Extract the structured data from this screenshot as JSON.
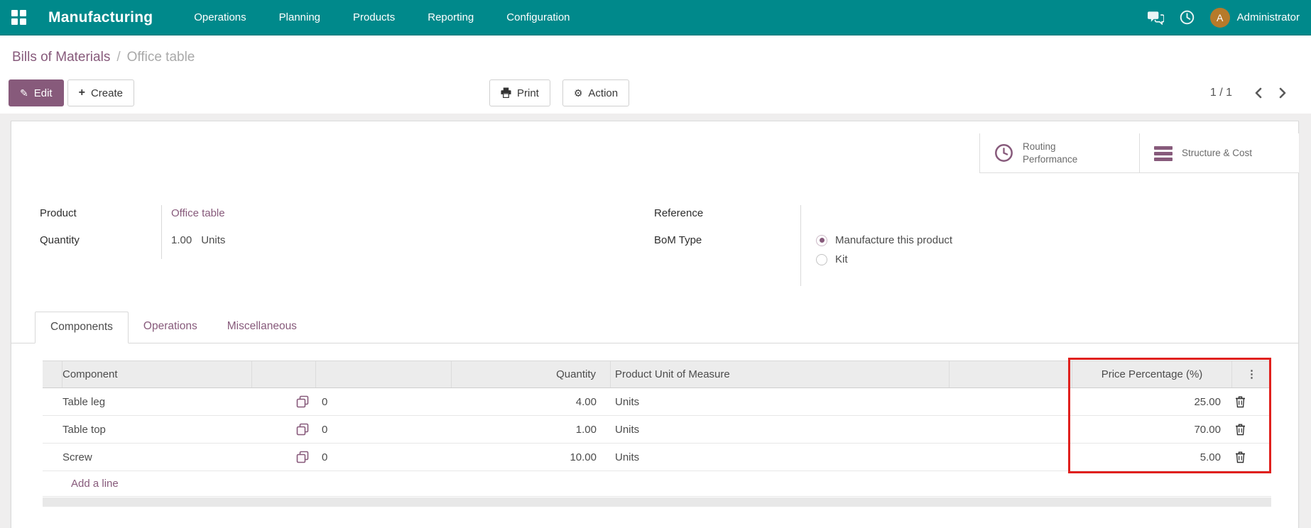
{
  "nav": {
    "app_name": "Manufacturing",
    "items": [
      "Operations",
      "Planning",
      "Products",
      "Reporting",
      "Configuration"
    ],
    "user": {
      "initial": "A",
      "name": "Administrator"
    }
  },
  "breadcrumb": {
    "parent": "Bills of Materials",
    "separator": "/",
    "current": "Office table"
  },
  "buttons": {
    "edit": "Edit",
    "create": "Create",
    "print": "Print",
    "action": "Action"
  },
  "pager": {
    "value": "1 / 1"
  },
  "smart_buttons": [
    {
      "label": "Routing Performance",
      "icon": "clock"
    },
    {
      "label": "Structure & Cost",
      "icon": "bars"
    }
  ],
  "form": {
    "product": {
      "label": "Product",
      "value": "Office table"
    },
    "quantity": {
      "label": "Quantity",
      "value": "1.00",
      "uom": "Units"
    },
    "reference": {
      "label": "Reference",
      "value": ""
    },
    "bom_type": {
      "label": "BoM Type",
      "options": [
        {
          "label": "Manufacture this product",
          "selected": true
        },
        {
          "label": "Kit",
          "selected": false
        }
      ]
    }
  },
  "tabs": [
    {
      "label": "Components",
      "active": true
    },
    {
      "label": "Operations",
      "active": false
    },
    {
      "label": "Miscellaneous",
      "active": false
    }
  ],
  "table": {
    "headers": {
      "component": "Component",
      "quantity": "Quantity",
      "uom": "Product Unit of Measure",
      "price": "Price Percentage (%)"
    },
    "rows": [
      {
        "component": "Table leg",
        "variant_count": "0",
        "quantity": "4.00",
        "uom": "Units",
        "price": "25.00"
      },
      {
        "component": "Table top",
        "variant_count": "0",
        "quantity": "1.00",
        "uom": "Units",
        "price": "70.00"
      },
      {
        "component": "Screw",
        "variant_count": "0",
        "quantity": "10.00",
        "uom": "Units",
        "price": "5.00"
      }
    ],
    "add_line": "Add a line"
  },
  "colors": {
    "navbar": "#00898B",
    "primary": "#875A7B",
    "highlight_box": "#E0201D",
    "avatar": "#B67A2A",
    "header_bg": "#ececec"
  }
}
